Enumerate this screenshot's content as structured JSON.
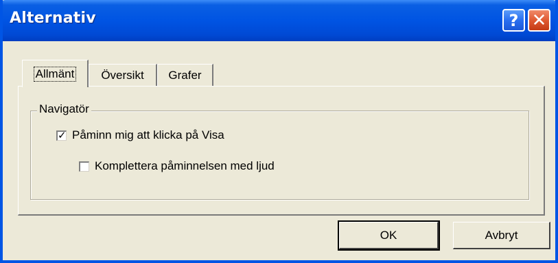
{
  "window": {
    "title": "Alternativ",
    "help_glyph": "?",
    "close_glyph": "✕"
  },
  "tabs": [
    {
      "label": "Allmänt",
      "active": true
    },
    {
      "label": "Översikt",
      "active": false
    },
    {
      "label": "Grafer",
      "active": false
    }
  ],
  "navigator_group": {
    "label": "Navigatör",
    "remind_checkbox": {
      "label": "Påminn mig att klicka på Visa",
      "checked": true,
      "mark": "✓"
    },
    "sound_checkbox": {
      "label": "Komplettera påminnelsen med ljud",
      "checked": false,
      "mark": ""
    }
  },
  "buttons": {
    "ok_label": "OK",
    "cancel_label": "Avbryt"
  },
  "colors": {
    "titlebar": "#0054e3",
    "window_face": "#ece9d8",
    "close_button": "#e05a32",
    "help_button": "#2a6ff0"
  },
  "icons": {
    "help": "help-icon",
    "close": "close-icon",
    "check": "checkmark-icon"
  }
}
